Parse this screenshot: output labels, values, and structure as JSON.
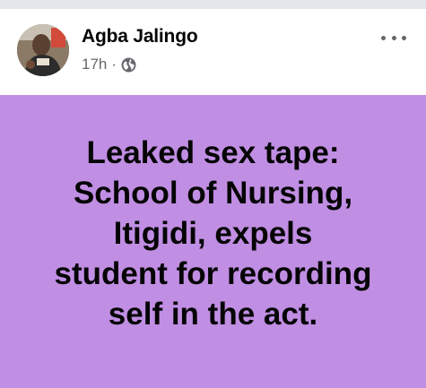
{
  "post": {
    "author": "Agba Jalingo",
    "time": "17h",
    "separator": "·",
    "privacy_icon": "globe-icon",
    "more_icon": "more-options-icon",
    "status_text": "Leaked sex tape:\nSchool of Nursing,\nItigidi, expels\nstudent for recording\nself in the act.",
    "background_color": "#c08ee3"
  }
}
